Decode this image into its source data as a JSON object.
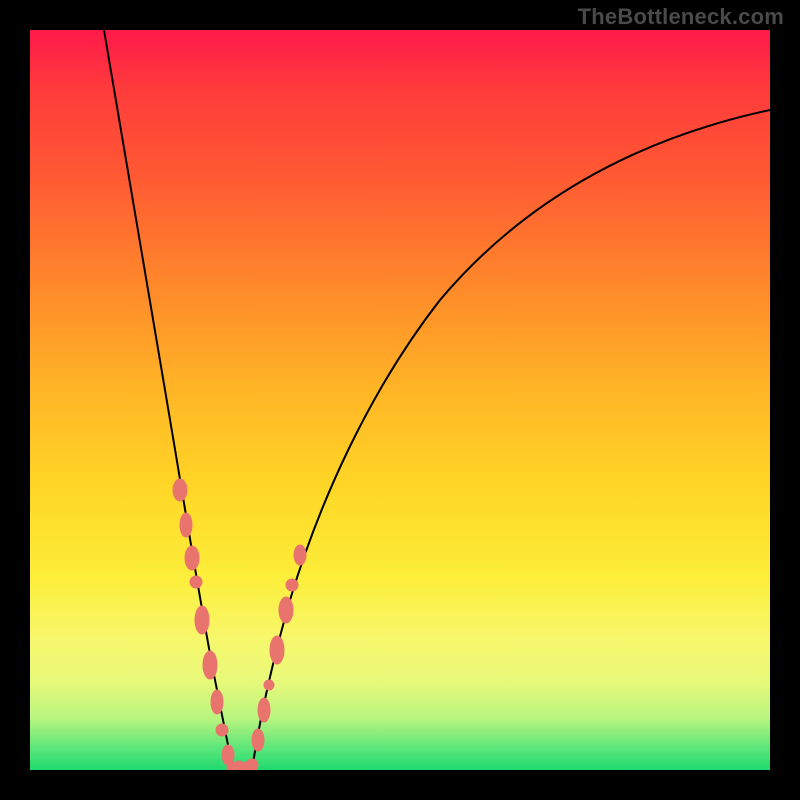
{
  "watermark": "TheBottleneck.com",
  "chart_data": {
    "type": "line",
    "title": "",
    "xlabel": "",
    "ylabel": "",
    "xlim": [
      0,
      100
    ],
    "ylim": [
      0,
      100
    ],
    "grid": false,
    "legend": false,
    "annotations": [],
    "series": [
      {
        "name": "left-branch",
        "x": [
          10,
          12,
          14,
          16,
          18,
          20,
          22,
          24,
          25,
          26,
          27
        ],
        "values": [
          100,
          88,
          75,
          62,
          50,
          38,
          26,
          14,
          8,
          3,
          0
        ]
      },
      {
        "name": "right-branch",
        "x": [
          30,
          31,
          33,
          36,
          40,
          46,
          54,
          64,
          76,
          90,
          100
        ],
        "values": [
          0,
          4,
          11,
          21,
          33,
          46,
          58,
          69,
          78,
          85,
          89
        ]
      },
      {
        "name": "beads-left",
        "x": [
          20.0,
          21.2,
          22.4,
          22.9,
          24.0,
          25.2,
          25.9,
          27.0
        ],
        "values": [
          38,
          31,
          24,
          21,
          14,
          7,
          3,
          0
        ]
      },
      {
        "name": "beads-right",
        "x": [
          30.0,
          30.8,
          31.6,
          33.0,
          34.5,
          35.5,
          36.0
        ],
        "values": [
          0,
          3,
          6,
          11,
          16,
          19,
          21
        ]
      }
    ],
    "colors": {
      "curve": "#000000",
      "beads": "#e9746e",
      "gradient_top": "#ff1a4a",
      "gradient_bottom": "#1ed96e"
    }
  }
}
